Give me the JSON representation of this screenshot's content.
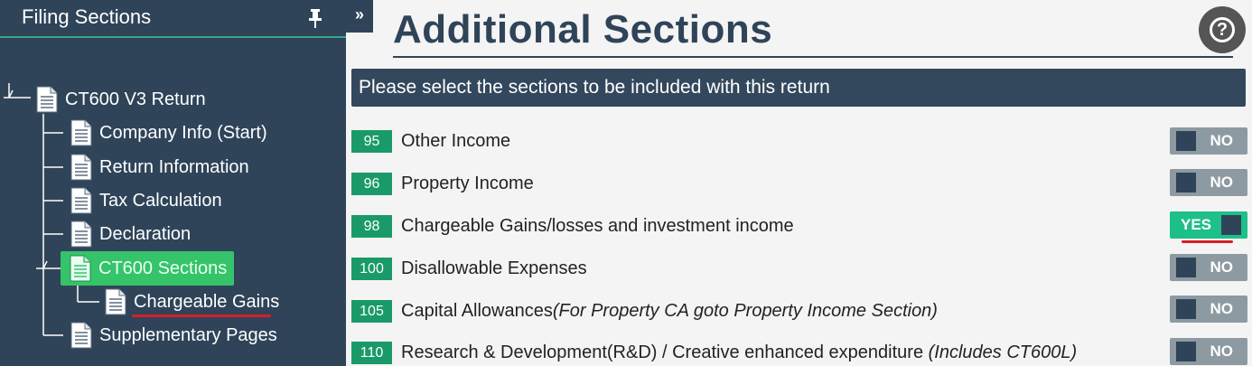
{
  "sidebar": {
    "title": "Filing Sections",
    "tree": {
      "root": "CT600 V3 Return",
      "items": [
        "Company Info (Start)",
        "Return Information",
        "Tax Calculation",
        "Declaration",
        "CT600 Sections",
        "Chargeable Gains",
        "Supplementary Pages"
      ]
    }
  },
  "expand_label": "»",
  "main": {
    "title": "Additional Sections",
    "help_label": "?",
    "banner": "Please select the sections to be included with this return",
    "sections": [
      {
        "num": "95",
        "label": "Other Income",
        "note": "",
        "state": "NO"
      },
      {
        "num": "96",
        "label": "Property Income",
        "note": "",
        "state": "NO"
      },
      {
        "num": "98",
        "label": "Chargeable Gains/losses and investment income",
        "note": "",
        "state": "YES"
      },
      {
        "num": "100",
        "label": "Disallowable Expenses",
        "note": "",
        "state": "NO"
      },
      {
        "num": "105",
        "label": "Capital Allowances",
        "note": "(For Property CA goto Property Income Section)",
        "state": "NO"
      },
      {
        "num": "110",
        "label": "Research & Development(R&D) / Creative enhanced expenditure ",
        "note": "(Includes CT600L)",
        "state": "NO"
      }
    ]
  },
  "colors": {
    "sidebar_bg": "#2f4459",
    "number_badge": "#1a9a69",
    "toggle_on": "#1fbf8a",
    "toggle_off": "#8d9aa1",
    "selected_node": "#35c46a",
    "annotation_red": "#d81e2a"
  }
}
